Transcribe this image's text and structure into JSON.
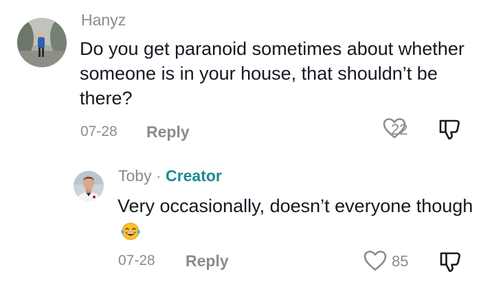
{
  "comments": [
    {
      "username": "Hanyz",
      "text": "Do you get paranoid sometimes about whether someone is in your house, that shouldn’t be there?",
      "date": "07-28",
      "reply_label": "Reply",
      "likes": "22",
      "avatar_icon": "avatar-photo-misty-forest"
    },
    {
      "username": "Toby",
      "separator": "·",
      "badge": "Creator",
      "text": "Very occasionally, doesn’t everyone though",
      "emoji_icon": "laughing-tears-emoji",
      "date": "07-28",
      "reply_label": "Reply",
      "likes": "85",
      "avatar_icon": "avatar-photo-man"
    }
  ],
  "colors": {
    "text": "#161823",
    "muted": "#8a8b91",
    "creator_badge": "#1b8a94"
  }
}
